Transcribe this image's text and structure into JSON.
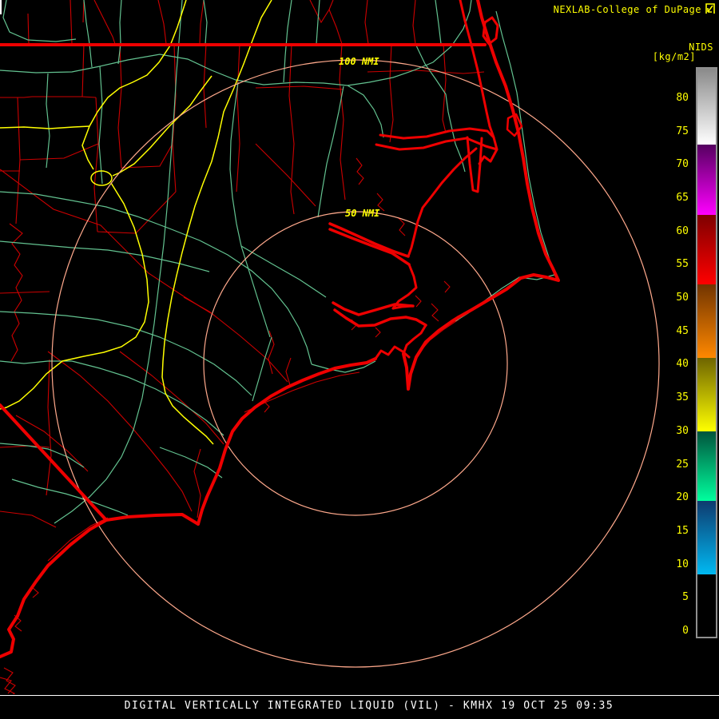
{
  "header": {
    "title": "NEXLAB-College of DuPage",
    "icon": "expand-arrow-icon"
  },
  "palette": {
    "title": "NIDS",
    "units": "[kg/m2]",
    "border_color": "#8f8f8f",
    "label_color": "#ffff00",
    "scale_min": 0,
    "scale_max": 85,
    "ticks": [
      "80",
      "75",
      "70",
      "65",
      "60",
      "55",
      "50",
      "45",
      "40",
      "35",
      "30",
      "25",
      "20",
      "15",
      "10",
      "5",
      "0"
    ],
    "segments": [
      {
        "from": 73,
        "to": 85,
        "color_top": "#8a8a8a",
        "color_bottom": "#ffffff"
      },
      {
        "from": 62.5,
        "to": 73,
        "color_top": "#550060",
        "color_bottom": "#ff00ff"
      },
      {
        "from": 52,
        "to": 62.5,
        "color_top": "#7e0000",
        "color_bottom": "#ff0000"
      },
      {
        "from": 41,
        "to": 52,
        "color_top": "#713400",
        "color_bottom": "#ff8800"
      },
      {
        "from": 30,
        "to": 41,
        "color_top": "#6e6400",
        "color_bottom": "#ffff00"
      },
      {
        "from": 19.5,
        "to": 30,
        "color_top": "#00543c",
        "color_bottom": "#00ff9e"
      },
      {
        "from": 8.5,
        "to": 19.5,
        "color_top": "#0e3a6e",
        "color_bottom": "#00b9f2"
      },
      {
        "from": 0,
        "to": 8.5,
        "color_top": "#000000",
        "color_bottom": "#000000"
      }
    ]
  },
  "map": {
    "rings": {
      "outer_label": "100 NMI",
      "inner_label": "50 NMI"
    },
    "colors": {
      "county_lines": "#cc0000",
      "state_coast_lines": "#ee0000",
      "roads": "#63c290",
      "interstates": "#ffff00",
      "range_rings": "#ffa98c",
      "tick_white": "#ffffff"
    }
  },
  "status": {
    "text": "DIGITAL VERTICALLY INTEGRATED LIQUID (VIL) - KMHX 19 OCT 25 09:35"
  }
}
